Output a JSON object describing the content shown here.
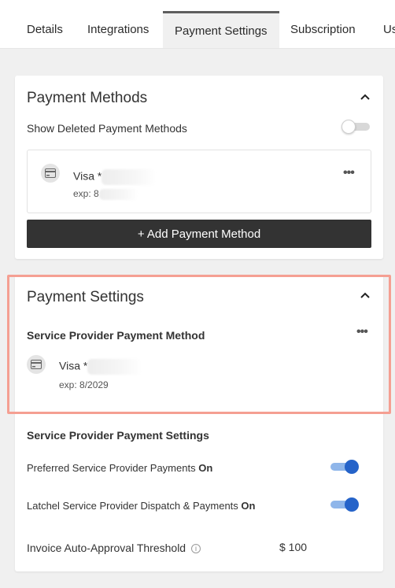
{
  "tabs": [
    {
      "label": "Details"
    },
    {
      "label": "Integrations"
    },
    {
      "label": "Payment Settings"
    },
    {
      "label": "Subscription"
    },
    {
      "label": "Us"
    }
  ],
  "active_tab": "Payment Settings",
  "payment_methods": {
    "title": "Payment Methods",
    "show_deleted_label": "Show Deleted Payment Methods",
    "show_deleted_on": false,
    "card": {
      "brand": "Visa *",
      "exp": "exp: 8"
    },
    "add_button": "+ Add Payment Method"
  },
  "payment_settings": {
    "title": "Payment Settings",
    "sp_method_heading": "Service Provider Payment Method",
    "sp_card": {
      "brand": "Visa *",
      "exp": "exp: 8/2029"
    },
    "sp_settings_heading": "Service Provider Payment Settings",
    "preferred": {
      "label": "Preferred Service Provider Payments",
      "state": "On",
      "enabled": true
    },
    "dispatch": {
      "label": "Latchel Service Provider Dispatch & Payments",
      "state": "On",
      "enabled": true
    },
    "threshold": {
      "label": "Invoice Auto-Approval Threshold",
      "value": "$ 100"
    }
  },
  "colors": {
    "toggle_on": "#2563c9",
    "highlight": "#f59f92",
    "button": "#333333"
  }
}
